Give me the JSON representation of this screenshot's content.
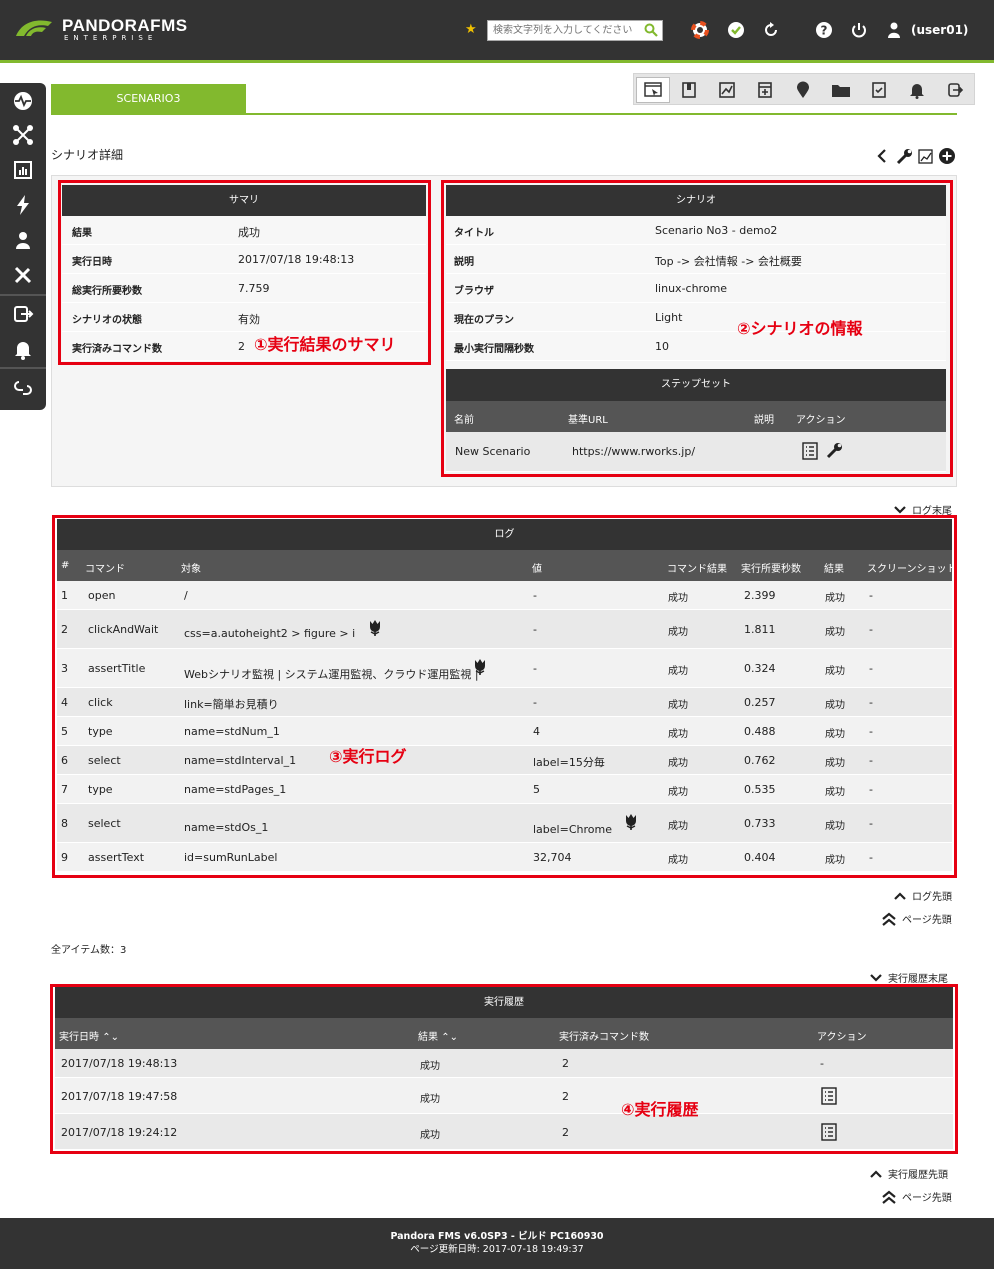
{
  "header": {
    "logo_name": "PANDORAFMS",
    "logo_sub": "ENTERPRISE",
    "search_placeholder": "検索文字列を入力してください",
    "user": "(user01)"
  },
  "tabs": {
    "active": "SCENARIO3"
  },
  "page": {
    "title": "シナリオ詳細"
  },
  "summary": {
    "title": "サマリ",
    "rows": [
      {
        "k": "結果",
        "v": "成功"
      },
      {
        "k": "実行日時",
        "v": "2017/07/18 19:48:13"
      },
      {
        "k": "総実行所要秒数",
        "v": "7.759"
      },
      {
        "k": "シナリオの状態",
        "v": "有効"
      },
      {
        "k": "実行済みコマンド数",
        "v": "2"
      }
    ]
  },
  "scenario": {
    "title": "シナリオ",
    "rows": [
      {
        "k": "タイトル",
        "v": "Scenario No3 - demo2"
      },
      {
        "k": "説明",
        "v": "Top -> 会社情報 -> 会社概要"
      },
      {
        "k": "ブラウザ",
        "v": "linux-chrome"
      },
      {
        "k": "現在のプラン",
        "v": "Light"
      },
      {
        "k": "最小実行間隔秒数",
        "v": "10"
      }
    ]
  },
  "stepset": {
    "title": "ステップセット",
    "headers": [
      "名前",
      "基準URL",
      "説明",
      "アクション"
    ],
    "row": {
      "name": "New Scenario",
      "url": "https://www.rworks.jp/",
      "desc": ""
    }
  },
  "log": {
    "nav_end": "ログ末尾",
    "title": "ログ",
    "headers": [
      "#",
      "コマンド",
      "対象",
      "値",
      "コマンド結果",
      "実行所要秒数",
      "結果",
      "スクリーンショット"
    ],
    "rows": [
      {
        "n": "1",
        "cmd": "open",
        "target": "/",
        "value": "-",
        "cres": "成功",
        "sec": "2.399",
        "res": "成功",
        "shot": "-"
      },
      {
        "n": "2",
        "cmd": "clickAndWait",
        "target": "css=a.autoheight2 > figure > i",
        "value": "-",
        "cres": "成功",
        "sec": "1.811",
        "res": "成功",
        "shot": "-"
      },
      {
        "n": "3",
        "cmd": "assertTitle",
        "target": "Webシナリオ監視 | システム運用監視、クラウド運用監視 |",
        "value": "-",
        "cres": "成功",
        "sec": "0.324",
        "res": "成功",
        "shot": "-"
      },
      {
        "n": "4",
        "cmd": "click",
        "target": "link=簡単お見積り",
        "value": "-",
        "cres": "成功",
        "sec": "0.257",
        "res": "成功",
        "shot": "-"
      },
      {
        "n": "5",
        "cmd": "type",
        "target": "name=stdNum_1",
        "value": "4",
        "cres": "成功",
        "sec": "0.488",
        "res": "成功",
        "shot": "-"
      },
      {
        "n": "6",
        "cmd": "select",
        "target": "name=stdInterval_1",
        "value": "label=15分毎",
        "cres": "成功",
        "sec": "0.762",
        "res": "成功",
        "shot": "-"
      },
      {
        "n": "7",
        "cmd": "type",
        "target": "name=stdPages_1",
        "value": "5",
        "cres": "成功",
        "sec": "0.535",
        "res": "成功",
        "shot": "-"
      },
      {
        "n": "8",
        "cmd": "select",
        "target": "name=stdOs_1",
        "value": "label=Chrome",
        "cres": "成功",
        "sec": "0.733",
        "res": "成功",
        "shot": "-"
      },
      {
        "n": "9",
        "cmd": "assertText",
        "target": "id=sumRunLabel",
        "value": "32,704",
        "cres": "成功",
        "sec": "0.404",
        "res": "成功",
        "shot": "-"
      }
    ],
    "nav_top": "ログ先頭",
    "page_top": "ページ先頭"
  },
  "items_total": "全アイテム数：3",
  "history": {
    "nav_end": "実行履歴末尾",
    "title": "実行履歴",
    "headers": [
      "実行日時",
      "結果",
      "実行済みコマンド数",
      "アクション"
    ],
    "rows": [
      {
        "date": "2017/07/18 19:48:13",
        "res": "成功",
        "count": "2",
        "action": "-"
      },
      {
        "date": "2017/07/18 19:47:58",
        "res": "成功",
        "count": "2",
        "action": ""
      },
      {
        "date": "2017/07/18 19:24:12",
        "res": "成功",
        "count": "2",
        "action": ""
      }
    ],
    "nav_top": "実行履歴先頭",
    "page_top": "ページ先頭"
  },
  "annotations": {
    "a1": "①実行結果のサマリ",
    "a2": "②シナリオの情報",
    "a3": "③実行ログ",
    "a4": "④実行履歴"
  },
  "footer": {
    "line1": "Pandora FMS v6.0SP3 - ビルド PC160930",
    "line2": "ページ更新日時: 2017-07-18 19:49:37"
  },
  "colors": {
    "accent": "#82b92e",
    "dark": "#333333",
    "annotation": "#e60012"
  }
}
